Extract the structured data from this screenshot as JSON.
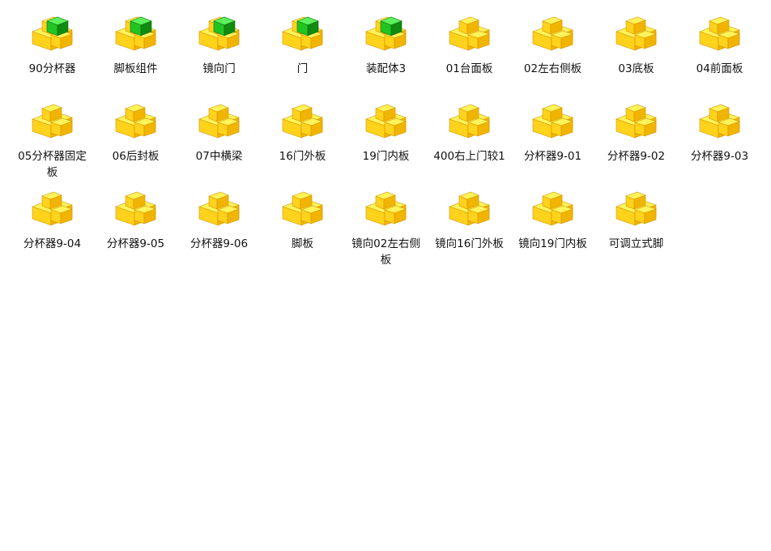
{
  "colors": {
    "part_face_top": "#fff35a",
    "part_face_left": "#ffd21c",
    "part_face_right": "#f1b400",
    "part_edge": "#d49500",
    "assembly_accent_top": "#5cf05c",
    "assembly_accent_left": "#22c422",
    "assembly_accent_right": "#118a11",
    "label_text": "#111111"
  },
  "files": [
    {
      "name": "90分杯器",
      "type": "assembly",
      "icon": "solidworks-assembly-icon"
    },
    {
      "name": "脚板组件",
      "type": "assembly",
      "icon": "solidworks-assembly-icon"
    },
    {
      "name": "镜向门",
      "type": "assembly",
      "icon": "solidworks-assembly-icon"
    },
    {
      "name": "门",
      "type": "assembly",
      "icon": "solidworks-assembly-icon"
    },
    {
      "name": "装配体3",
      "type": "assembly",
      "icon": "solidworks-assembly-icon"
    },
    {
      "name": "01台面板",
      "type": "part",
      "icon": "solidworks-part-icon"
    },
    {
      "name": "02左右侧板",
      "type": "part",
      "icon": "solidworks-part-icon"
    },
    {
      "name": "03底板",
      "type": "part",
      "icon": "solidworks-part-icon"
    },
    {
      "name": "04前面板",
      "type": "part",
      "icon": "solidworks-part-icon"
    },
    {
      "name": "05分杯器固定板",
      "type": "part",
      "icon": "solidworks-part-icon"
    },
    {
      "name": "06后封板",
      "type": "part",
      "icon": "solidworks-part-icon"
    },
    {
      "name": "07中横梁",
      "type": "part",
      "icon": "solidworks-part-icon"
    },
    {
      "name": "16门外板",
      "type": "part",
      "icon": "solidworks-part-icon"
    },
    {
      "name": "19门内板",
      "type": "part",
      "icon": "solidworks-part-icon"
    },
    {
      "name": "400右上门较1",
      "type": "part",
      "icon": "solidworks-part-icon"
    },
    {
      "name": "分杯器9-01",
      "type": "part",
      "icon": "solidworks-part-icon"
    },
    {
      "name": "分杯器9-02",
      "type": "part",
      "icon": "solidworks-part-icon"
    },
    {
      "name": "分杯器9-03",
      "type": "part",
      "icon": "solidworks-part-icon"
    },
    {
      "name": "分杯器9-04",
      "type": "part",
      "icon": "solidworks-part-icon"
    },
    {
      "name": "分杯器9-05",
      "type": "part",
      "icon": "solidworks-part-icon"
    },
    {
      "name": "分杯器9-06",
      "type": "part",
      "icon": "solidworks-part-icon"
    },
    {
      "name": "脚板",
      "type": "part",
      "icon": "solidworks-part-icon"
    },
    {
      "name": "镜向02左右侧板",
      "type": "part",
      "icon": "solidworks-part-icon"
    },
    {
      "name": "镜向16门外板",
      "type": "part",
      "icon": "solidworks-part-icon"
    },
    {
      "name": "镜向19门内板",
      "type": "part",
      "icon": "solidworks-part-icon"
    },
    {
      "name": "可调立式脚",
      "type": "part",
      "icon": "solidworks-part-icon"
    }
  ]
}
